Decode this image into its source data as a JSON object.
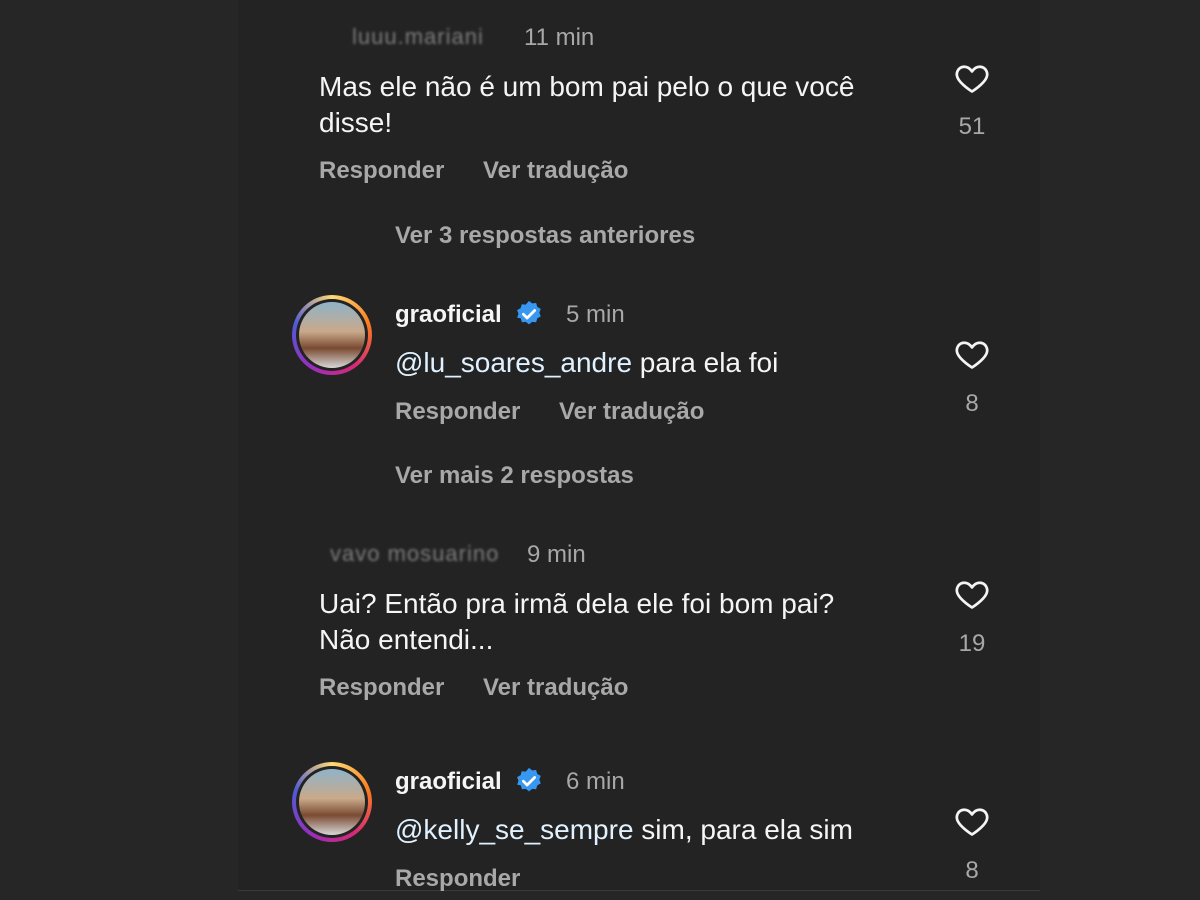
{
  "comments": [
    {
      "username": "luuu.mariani",
      "time": "11 min",
      "text_line1": "Mas ele não é um bom pai pelo o que você",
      "text_line2": "disse!",
      "reply_label": "Responder",
      "translate_label": "Ver tradução",
      "likes": "51"
    },
    {
      "view_previous": "Ver 3 respostas anteriores"
    },
    {
      "username": "graoficial",
      "verified": true,
      "time": "5 min",
      "mention": "@lu_soares_andre",
      "text": " para ela foi",
      "reply_label": "Responder",
      "translate_label": "Ver tradução",
      "likes": "8"
    },
    {
      "view_more": "Ver mais 2 respostas"
    },
    {
      "username": "vavo mosuarino",
      "time": "9 min",
      "text_line1": "Uai? Então pra irmã dela ele foi bom pai?",
      "text_line2": "Não entendi...",
      "reply_label": "Responder",
      "translate_label": "Ver tradução",
      "likes": "19"
    },
    {
      "username": "graoficial",
      "verified": true,
      "time": "6 min",
      "mention": "@kelly_se_sempre",
      "text": " sim, para ela sim",
      "reply_label": "Responder",
      "likes": "8"
    }
  ],
  "colors": {
    "background": "#262626",
    "text_primary": "#f5f5f5",
    "text_secondary": "#a8a8a8",
    "mention": "#e0f1ff",
    "verified_badge": "#3897f0"
  },
  "icons": {
    "like": "heart-outline-icon",
    "verified": "verified-badge-icon"
  }
}
